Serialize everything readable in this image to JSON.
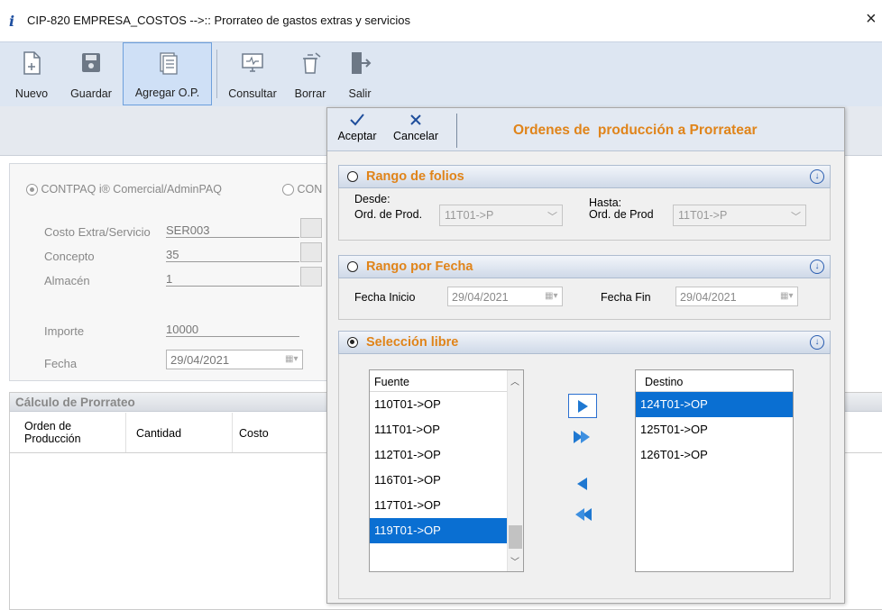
{
  "window": {
    "title": "CIP-820 EMPRESA_COSTOS -->:: Prorrateo de gastos extras y servicios"
  },
  "toolbar": {
    "nuevo": "Nuevo",
    "guardar": "Guardar",
    "agregar": "Agregar O.P.",
    "consultar": "Consultar",
    "borrar": "Borrar",
    "salir": "Salir"
  },
  "form": {
    "radio1": "CONTPAQ i® Comercial/AdminPAQ",
    "radio2": "CON",
    "costo_label": "Costo Extra/Servicio",
    "costo_value": "SER003",
    "concepto_label": "Concepto",
    "concepto_value": "35",
    "almacen_label": "Almacén",
    "almacen_value": "1",
    "importe_label": "Importe",
    "importe_value": "10000",
    "fecha_label": "Fecha",
    "fecha_value": "29/04/2021"
  },
  "calc": {
    "title": "Cálculo de Prorrateo",
    "columns": [
      "Orden de\nProducción",
      "Cantidad",
      "Costo"
    ]
  },
  "dialog": {
    "aceptar": "Aceptar",
    "cancelar": "Cancelar",
    "title": "Ordenes de  producción a Prorratear",
    "sec1": {
      "title": "Rango de folios",
      "desde": "Desde:",
      "hasta": "Hasta:",
      "ord1_label": "Ord. de Prod.",
      "ord1_value": "11T01->P",
      "ord2_label": "Ord. de Prod",
      "ord2_value": "11T01->P"
    },
    "sec2": {
      "title": "Rango por Fecha",
      "inicio_label": "Fecha Inicio",
      "inicio_value": "29/04/2021",
      "fin_label": "Fecha Fin",
      "fin_value": "29/04/2021"
    },
    "sec3": {
      "title": "Selección libre",
      "fuente_header": "Fuente",
      "fuente_items": [
        "110T01->OP",
        "111T01->OP",
        "112T01->OP",
        "116T01->OP",
        "117T01->OP",
        "119T01->OP"
      ],
      "fuente_selected": "119T01->OP",
      "destino_header": "Destino",
      "destino_items": [
        "124T01->OP",
        "125T01->OP",
        "126T01->OP"
      ],
      "destino_selected": "124T01->OP"
    }
  },
  "colors": {
    "accent": "#0a6fd2",
    "section_title": "#e0841a",
    "toolbar_bg": "#dde6f2"
  }
}
